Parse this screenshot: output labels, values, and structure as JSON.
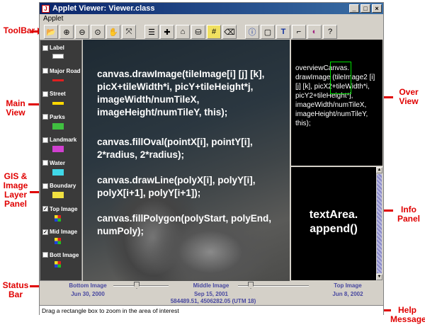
{
  "window": {
    "title": "Applet Viewer: Viewer.class",
    "menu": "Applet"
  },
  "callouts": {
    "toolbar": "ToolBar",
    "main_view": "Main\nView",
    "gis_panel": "GIS &\nImage\nLayer\nPanel",
    "status_bar": "Status\nBar",
    "over_view": "Over\nView",
    "info_panel": "Info\nPanel",
    "help_message": "Help\nMessage"
  },
  "layers": [
    {
      "label": "Label",
      "checked": false,
      "swatch": "#d4d0c8"
    },
    {
      "label": "Major Road",
      "checked": false,
      "swatch": "#e02020"
    },
    {
      "label": "Street",
      "checked": false,
      "swatch": "#ffd800"
    },
    {
      "label": "Parks",
      "checked": false,
      "swatch": "#40c040"
    },
    {
      "label": "Landmark",
      "checked": false,
      "swatch": "#d040d0"
    },
    {
      "label": "Water",
      "checked": false,
      "swatch": "#40d8e8"
    },
    {
      "label": "Boundary",
      "checked": false,
      "swatch": "#f0e040"
    },
    {
      "label": "Top Image",
      "checked": true,
      "swatch": "multi"
    },
    {
      "label": "Mid Image",
      "checked": true,
      "swatch": "multi"
    },
    {
      "label": "Bott Image",
      "checked": false,
      "swatch": "multi"
    }
  ],
  "main_code": [
    "canvas.drawImage(tileImage[i] [j] [k], picX+tileWidth*i, picY+tileHeight*j, imageWidth/numTileX, imageHeight/numTileY, this);",
    "canvas.fillOval(pointX[i], pointY[i], 2*radius, 2*radius);",
    "canvas.drawLine(polyX[i], polyY[i], polyX[i+1], polyY[i+1]);",
    "canvas.fillPolygon(polyStart, polyEnd, numPoly);"
  ],
  "overview_code": "overviewCanvas. drawImage (tileImage2 [i] [j] [k], picX2+tileWidth*i, picY2+tileHeight*j, imageWidth/numTileX, imageHeight/numTileY, this);",
  "info_text": "textArea.\nappend()",
  "status": {
    "bottom": {
      "name": "Bottom Image",
      "date": "Jun 30, 2000"
    },
    "middle": {
      "name": "Middle Image",
      "date": "Sep 15, 2001"
    },
    "top": {
      "name": "Top Image",
      "date": "Jun 8, 2002"
    },
    "coords": "584489.51, 4506282.05 (UTM 18)"
  },
  "help": "Drag a rectangle box to zoom in the area of interest",
  "toolbar_icons": [
    "open-icon",
    "zoom-in-icon",
    "zoom-out-icon",
    "zoom-custom-icon",
    "pan-hand-icon",
    "fit-icon",
    "layers-icon",
    "crosshair-icon",
    "measure-icon",
    "bucket-icon",
    "grid-icon",
    "eraser-icon",
    "info-icon",
    "rounded-rect-icon",
    "text-icon",
    "polyline-icon",
    "clip-icon",
    "help-icon"
  ]
}
